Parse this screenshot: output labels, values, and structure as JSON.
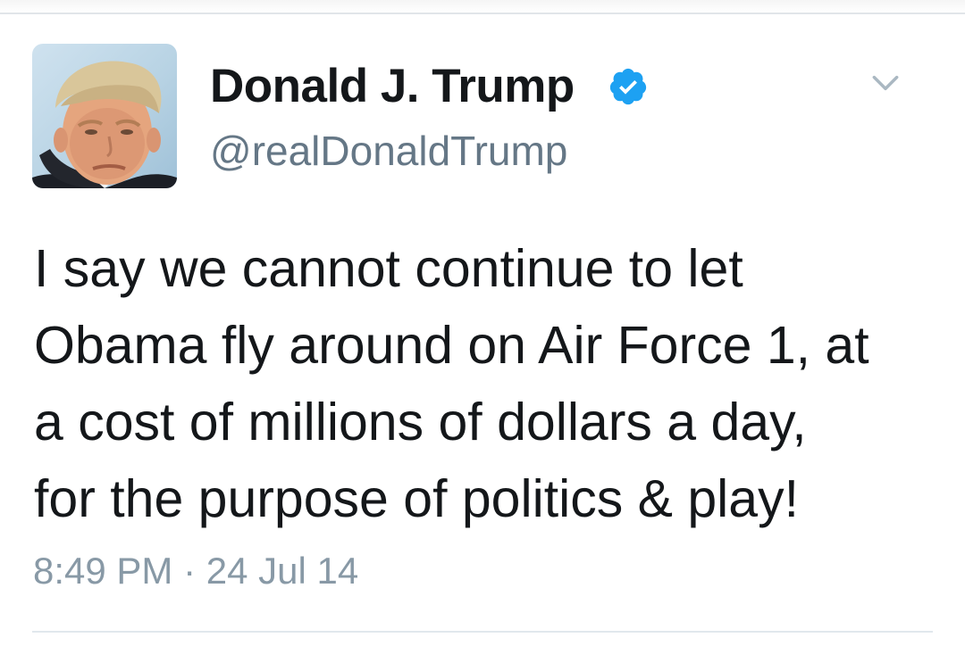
{
  "tweet": {
    "author": {
      "display_name": "Donald J. Trump",
      "handle": "@realDonaldTrump",
      "verified": true,
      "avatar_icon": "profile-photo"
    },
    "text_lines": [
      "I say we cannot continue to let",
      "Obama fly around on Air Force 1, at",
      "a cost of millions of dollars a day,",
      "for the purpose of politics & play!"
    ],
    "time": "8:49 PM",
    "separator": "·",
    "date": "24 Jul 14"
  },
  "icons": {
    "verified": "verified-badge-icon",
    "menu": "chevron-down-icon"
  },
  "colors": {
    "text_primary": "#14171a",
    "text_secondary": "#657786",
    "timestamp": "#8899a6",
    "verified_blue": "#1da1f2",
    "divider": "#e1e8ed"
  }
}
